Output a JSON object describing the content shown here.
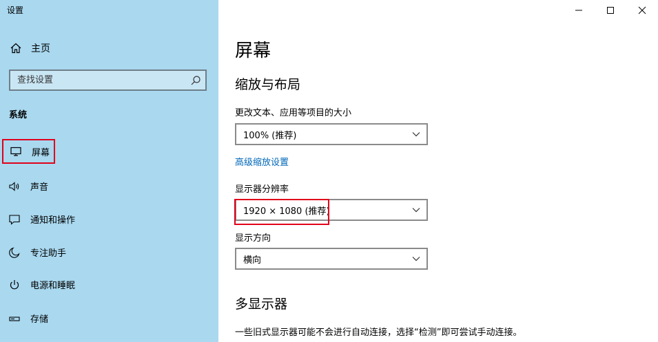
{
  "window": {
    "title": "设置"
  },
  "sidebar": {
    "home_label": "主页",
    "search_placeholder": "查找设置",
    "section_header": "系统",
    "items": [
      {
        "label": "屏幕",
        "icon": "monitor-icon"
      },
      {
        "label": "声音",
        "icon": "speaker-icon"
      },
      {
        "label": "通知和操作",
        "icon": "message-icon"
      },
      {
        "label": "专注助手",
        "icon": "moon-icon"
      },
      {
        "label": "电源和睡眠",
        "icon": "power-icon"
      },
      {
        "label": "存储",
        "icon": "storage-icon"
      }
    ]
  },
  "main": {
    "title": "屏幕",
    "scale_section": {
      "heading": "缩放与布局",
      "text_size_label": "更改文本、应用等项目的大小",
      "text_size_value": "100% (推荐)",
      "advanced_link": "高级缩放设置",
      "resolution_label": "显示器分辨率",
      "resolution_value": "1920 × 1080 (推荐)",
      "orientation_label": "显示方向",
      "orientation_value": "横向"
    },
    "multi_section": {
      "heading": "多显示器",
      "description": "一些旧式显示器可能不会进行自动连接，选择“检测”即可尝试手动连接。"
    }
  },
  "colors": {
    "sidebar_bg": "#a9d8ef",
    "highlight": "#e0001b",
    "link": "#0067b8"
  }
}
